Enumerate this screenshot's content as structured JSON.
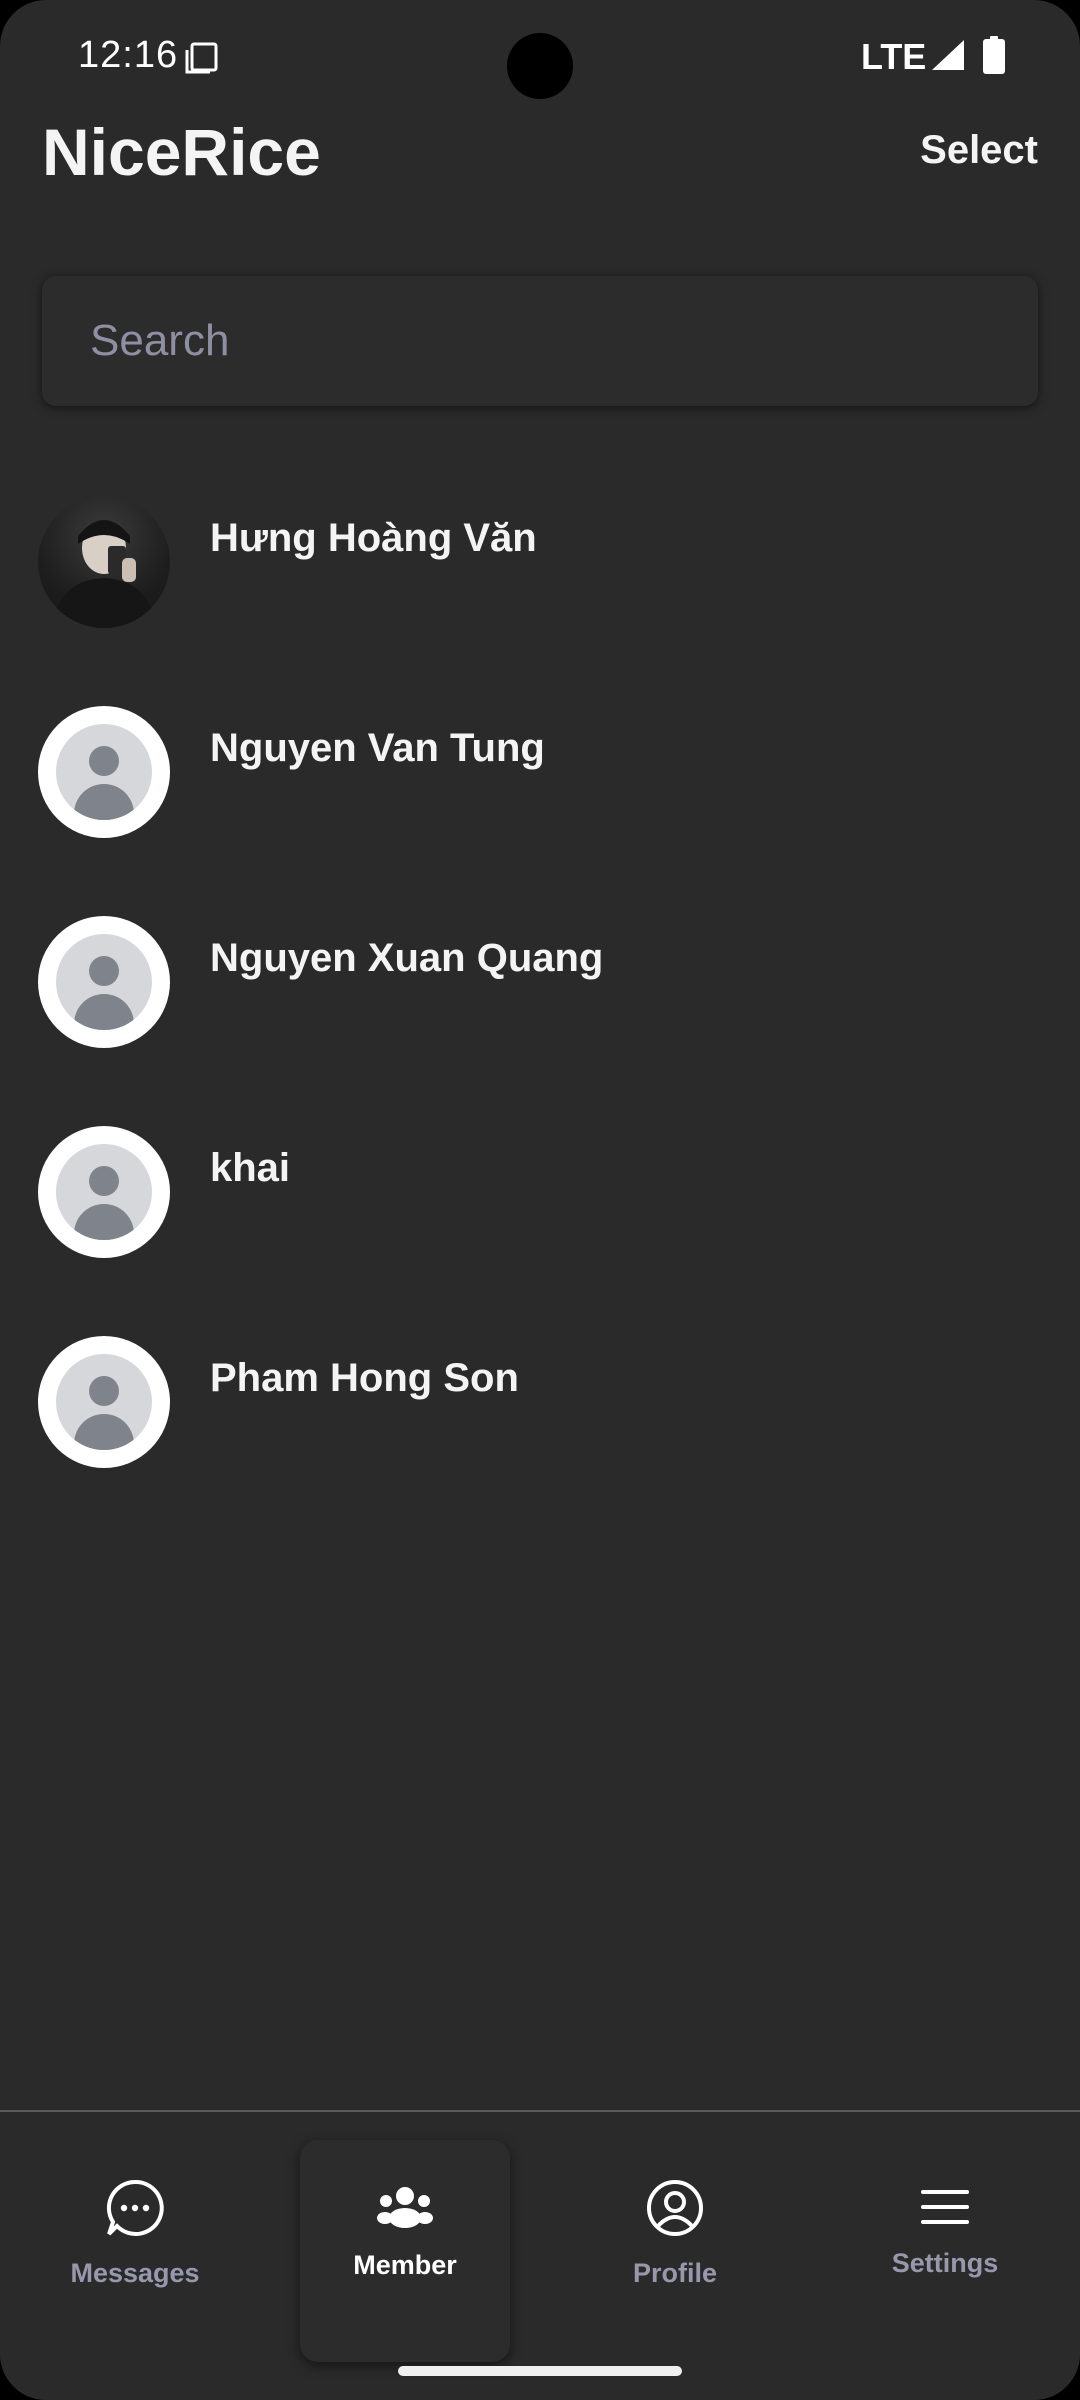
{
  "status_bar": {
    "time": "12:16",
    "network": "LTE"
  },
  "header": {
    "title": "NiceRice",
    "select_label": "Select"
  },
  "search": {
    "placeholder": "Search",
    "value": ""
  },
  "members": [
    {
      "name": "Hưng Hoàng Văn",
      "avatar": "photo"
    },
    {
      "name": "Nguyen Van Tung",
      "avatar": "default"
    },
    {
      "name": "Nguyen Xuan Quang",
      "avatar": "default"
    },
    {
      "name": "khai",
      "avatar": "default"
    },
    {
      "name": "Pham Hong Son",
      "avatar": "default"
    }
  ],
  "bottom_nav": {
    "items": [
      {
        "label": "Messages",
        "icon": "chat-bubble-icon",
        "active": false
      },
      {
        "label": "Member",
        "icon": "group-icon",
        "active": true
      },
      {
        "label": "Profile",
        "icon": "user-circle-icon",
        "active": false
      },
      {
        "label": "Settings",
        "icon": "menu-icon",
        "active": false
      }
    ]
  },
  "colors": {
    "background": "#2a2a2a",
    "text_primary": "#f4f4f4",
    "text_muted": "#9898ad",
    "placeholder": "#8f8fa3"
  }
}
